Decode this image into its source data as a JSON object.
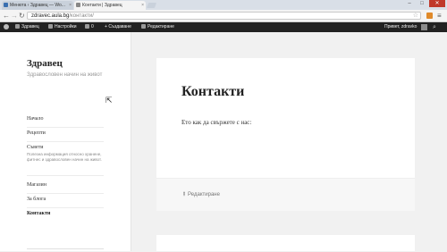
{
  "browser": {
    "tabs": [
      {
        "label": "Менюта ‹ Здравец — Wo..."
      },
      {
        "label": "Контакти | Здравец"
      }
    ],
    "url_host": "zdravec.aula.bg",
    "url_path": "/контакти/",
    "buttons": {
      "back": "←",
      "forward": "→",
      "reload": "↻",
      "menu": "≡",
      "star": "☆"
    },
    "window": {
      "minimize": "–",
      "maximize": "□",
      "close": "✕"
    }
  },
  "adminbar": {
    "site": "Здравец",
    "customize": "Настройки",
    "comments": "0",
    "new": "Създаване",
    "new_prefix": "+",
    "edit": "Редактиране",
    "howdy": "Привет, zdravko",
    "search_icon": "⌕"
  },
  "sidebar": {
    "title": "Здравец",
    "description": "Здравословен начин на живот",
    "menu": [
      {
        "label": "Начало"
      },
      {
        "label": "Рецепти"
      },
      {
        "label": "Съвети",
        "description": "Полезна информация относно хранене, фитнес и здравословен начин на живот."
      },
      {
        "label": "Магазин"
      },
      {
        "label": "За блога"
      },
      {
        "label": "Контакти",
        "active": true
      }
    ]
  },
  "article": {
    "title": "Контакти",
    "text": "Ето как да свържете с нас:",
    "edit_link": "Редактиране",
    "edit_icon": "✎"
  },
  "icons": {
    "wordpress": "wordpress-logo-icon",
    "comments": "comment-bubble-icon",
    "customize": "brush-icon",
    "edit": "pencil-icon"
  }
}
